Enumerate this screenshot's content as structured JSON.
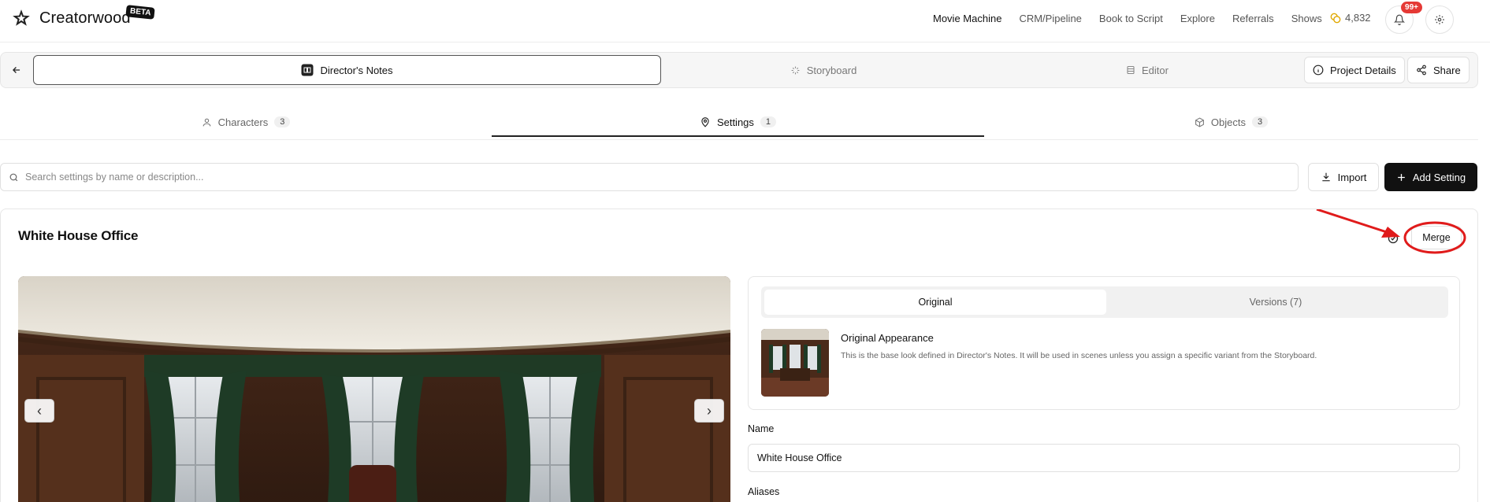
{
  "brand": {
    "name": "Creatorwood",
    "beta": "BETA"
  },
  "nav": {
    "links": [
      "Movie Machine",
      "CRM/Pipeline",
      "Book to Script",
      "Explore",
      "Referrals",
      "Shows"
    ],
    "credits": "4,832",
    "notifications_badge": "99+"
  },
  "modebar": {
    "tabs": [
      {
        "label": "Director's Notes",
        "icon": "book-icon",
        "active": true
      },
      {
        "label": "Storyboard",
        "icon": "sparkle-icon",
        "active": false
      },
      {
        "label": "Editor",
        "icon": "film-icon",
        "active": false
      }
    ],
    "project_details": "Project Details",
    "share": "Share"
  },
  "subtabs": [
    {
      "label": "Characters",
      "count": "3",
      "icon": "user-icon"
    },
    {
      "label": "Settings",
      "count": "1",
      "icon": "map-pin-icon",
      "active": true
    },
    {
      "label": "Objects",
      "count": "3",
      "icon": "box-icon"
    }
  ],
  "search": {
    "placeholder": "Search settings by name or description..."
  },
  "actions": {
    "import": "Import",
    "add": "Add Setting"
  },
  "setting": {
    "title": "White House Office",
    "merge": "Merge",
    "segments": [
      "Original",
      "Versions (7)"
    ],
    "original_title": "Original Appearance",
    "original_desc": "This is the base look defined in Director's Notes. It will be used in scenes unless you assign a specific variant from the Storyboard.",
    "name_label": "Name",
    "name_value": "White House Office",
    "aliases_label": "Aliases"
  },
  "colors": {
    "accent": "#111111",
    "annotation": "#e01b1b",
    "badge": "#e53935"
  }
}
